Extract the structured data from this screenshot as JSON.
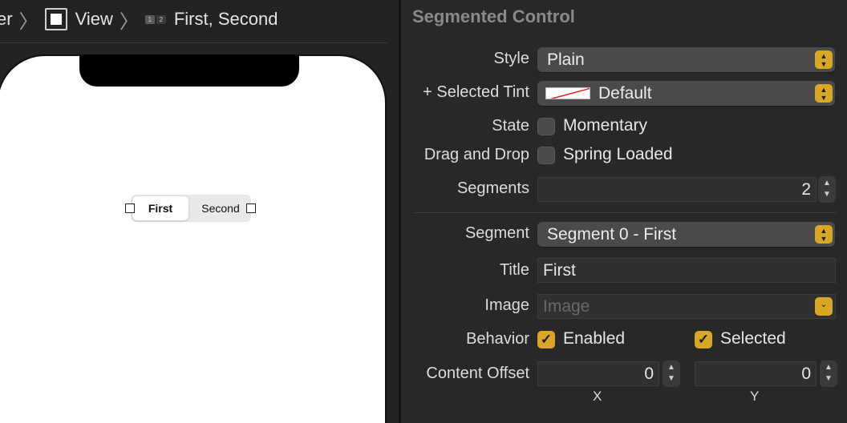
{
  "breadcrumb": {
    "lead": "er",
    "view_label": "View",
    "segment_label": "First, Second",
    "segment_icon": [
      "1",
      "2"
    ]
  },
  "canvas": {
    "segments": [
      "First",
      "Second"
    ],
    "selected_segment": 0
  },
  "inspector": {
    "title": "Segmented Control",
    "style": {
      "label": "Style",
      "value": "Plain"
    },
    "selected_tint": {
      "label": "+ Selected Tint",
      "value": "Default"
    },
    "state": {
      "label": "State",
      "option": "Momentary",
      "checked": false
    },
    "drag_drop": {
      "label": "Drag and Drop",
      "option": "Spring Loaded",
      "checked": false
    },
    "segments": {
      "label": "Segments",
      "value": "2"
    },
    "segment": {
      "label": "Segment",
      "value": "Segment 0 - First"
    },
    "title_field": {
      "label": "Title",
      "value": "First"
    },
    "image": {
      "label": "Image",
      "placeholder": "Image"
    },
    "behavior": {
      "label": "Behavior",
      "enabled": "Enabled",
      "selected": "Selected",
      "enabled_checked": true,
      "selected_checked": true
    },
    "content_offset": {
      "label": "Content Offset",
      "x_value": "0",
      "y_value": "0",
      "x_label": "X",
      "y_label": "Y"
    }
  },
  "colors": {
    "accent": "#d8a726",
    "panel": "#282828",
    "canvas_bg": "#232323"
  }
}
